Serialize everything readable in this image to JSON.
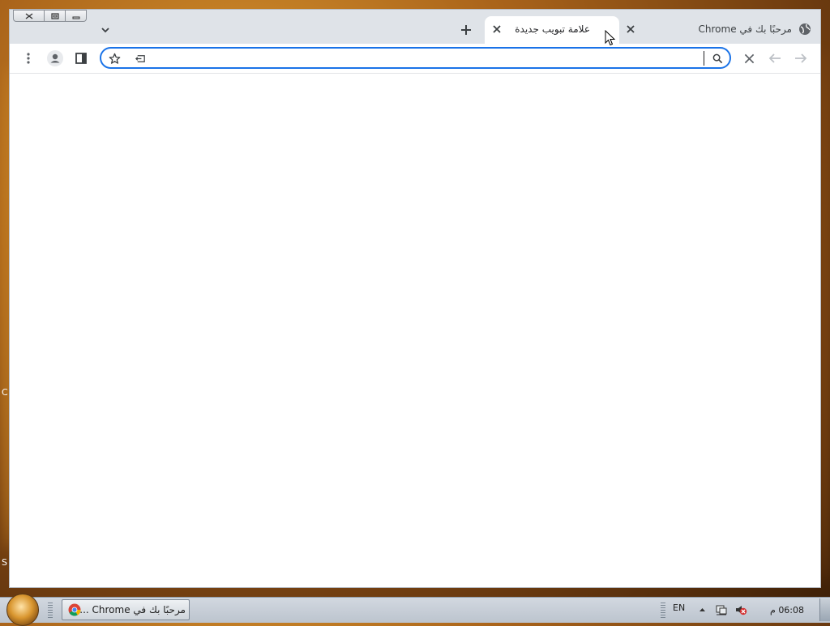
{
  "window": {
    "tabs": [
      {
        "title": "علامة تبويب جديدة",
        "active": true
      },
      {
        "title": "مرحبًا بك في Chrome",
        "active": false
      }
    ]
  },
  "toolbar": {
    "address_value": "",
    "address_placeholder": ""
  },
  "taskbar": {
    "task_button_label": "مرحبًا بك في Chrome ...",
    "language": "EN",
    "clock": "06:08 م"
  },
  "desktop": {
    "edge_letters": [
      "C",
      "S"
    ]
  },
  "colors": {
    "accent": "#1a73e8",
    "tabstrip": "#dfe3e8"
  }
}
